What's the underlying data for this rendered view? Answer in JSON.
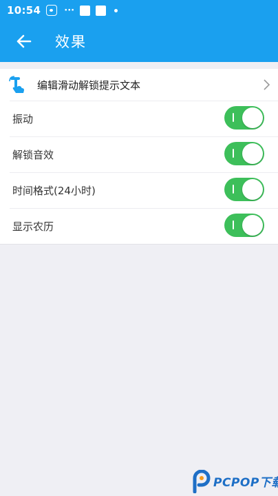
{
  "status_bar": {
    "time": "10:54",
    "dots": "···",
    "icons": [
      "baidu-paw-icon",
      "square-icon",
      "square-icon",
      "dot-icon"
    ]
  },
  "header": {
    "title": "效果",
    "back_icon": "arrow-left-icon",
    "background": "#1aa0ef"
  },
  "settings": {
    "slide_unlock_text": {
      "label": "编辑滑动解锁提示文本",
      "icon": "hand-pointer-icon",
      "chevron": "chevron-right-icon"
    },
    "toggles": [
      {
        "label": "振动",
        "on": true
      },
      {
        "label": "解锁音效",
        "on": true
      },
      {
        "label": "时间格式(24小时)",
        "on": true
      },
      {
        "label": "显示农历",
        "on": true
      }
    ],
    "switch_on_color": "#3dbf5a"
  },
  "watermark": {
    "text": "PCPOP下载"
  }
}
